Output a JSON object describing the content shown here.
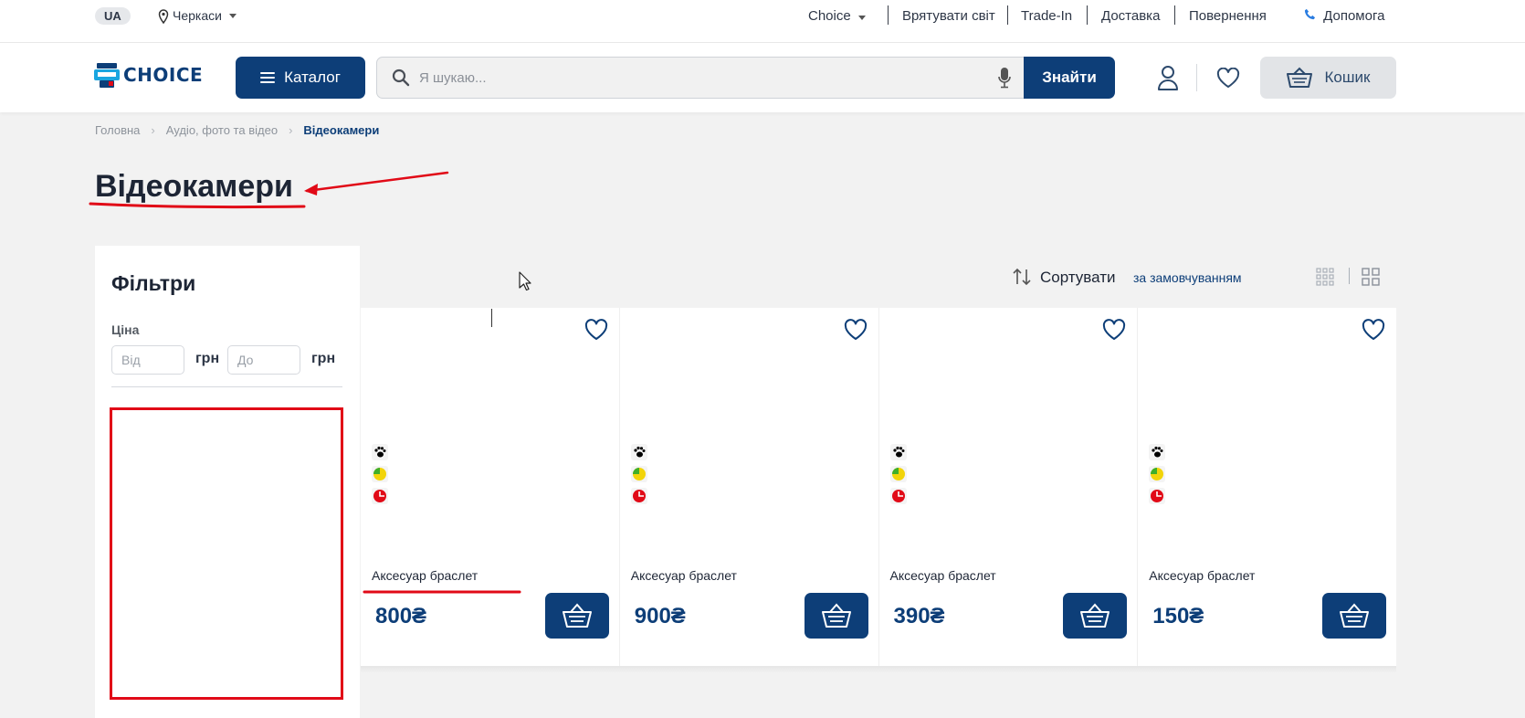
{
  "topbar": {
    "lang": "UA",
    "city": "Черкаси",
    "nav": [
      "Choice",
      "Врятувати світ",
      "Trade-In",
      "Доставка",
      "Повернення"
    ],
    "help": "Допомога"
  },
  "header": {
    "logo_text": "CHOICE",
    "catalog_label": "Каталог",
    "search_placeholder": "Я шукаю...",
    "search_button": "Знайти",
    "cart_label": "Кошик"
  },
  "breadcrumb": [
    "Головна",
    "Аудіо, фото та відео",
    "Відеокамери"
  ],
  "page_title": "Відеокамери",
  "filters": {
    "title": "Фільтри",
    "price_label": "Ціна",
    "from_placeholder": "Від",
    "to_placeholder": "До",
    "currency": "грн"
  },
  "sort": {
    "label": "Сортувати",
    "value": "за замовчуванням"
  },
  "products": [
    {
      "name": "Аксесуар браслет",
      "price": "800₴"
    },
    {
      "name": "Аксесуар браслет",
      "price": "900₴"
    },
    {
      "name": "Аксесуар браслет",
      "price": "390₴"
    },
    {
      "name": "Аксесуар браслет",
      "price": "150₴"
    }
  ],
  "colors": {
    "brand": "#0d3e78",
    "annotation": "#e10a17",
    "background": "#f2f2f2"
  },
  "icons": [
    "location-pin-icon",
    "phone-icon",
    "search-icon",
    "microphone-icon",
    "user-icon",
    "heart-icon",
    "basket-icon",
    "sort-icon",
    "grid-view-icon",
    "paw-icon",
    "eco-icon",
    "ukraine-badge-icon"
  ]
}
